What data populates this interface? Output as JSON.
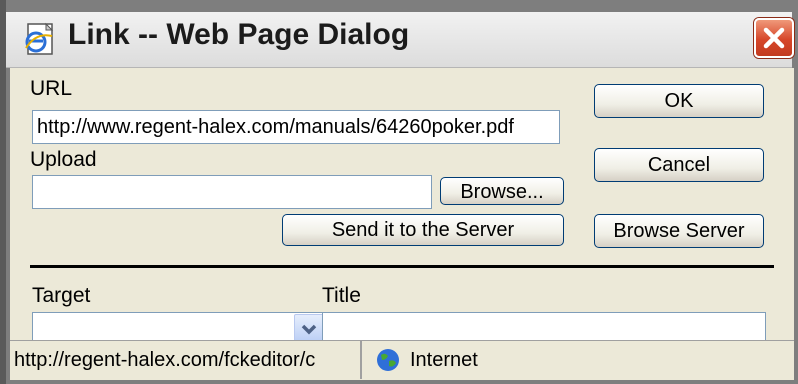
{
  "window": {
    "title": "Link -- Web Page Dialog"
  },
  "form": {
    "url_label": "URL",
    "url_value": "http://www.regent-halex.com/manuals/64260poker.pdf",
    "upload_label": "Upload",
    "upload_value": "",
    "target_label": "Target",
    "target_value": "",
    "title_label": "Title",
    "title_value": ""
  },
  "buttons": {
    "ok": "OK",
    "cancel": "Cancel",
    "browse": "Browse...",
    "send": "Send it to the Server",
    "browse_server": "Browse Server"
  },
  "status": {
    "url": "http://regent-halex.com/fckeditor/c",
    "zone": "Internet"
  },
  "icons": {
    "title": "ie-page-icon",
    "close": "close-icon",
    "dropdown": "chevron-down-icon",
    "zone": "globe-icon"
  },
  "colors": {
    "close_button": "#d6472a",
    "dialog_background": "#ece9d8",
    "button_border": "#003c74"
  }
}
